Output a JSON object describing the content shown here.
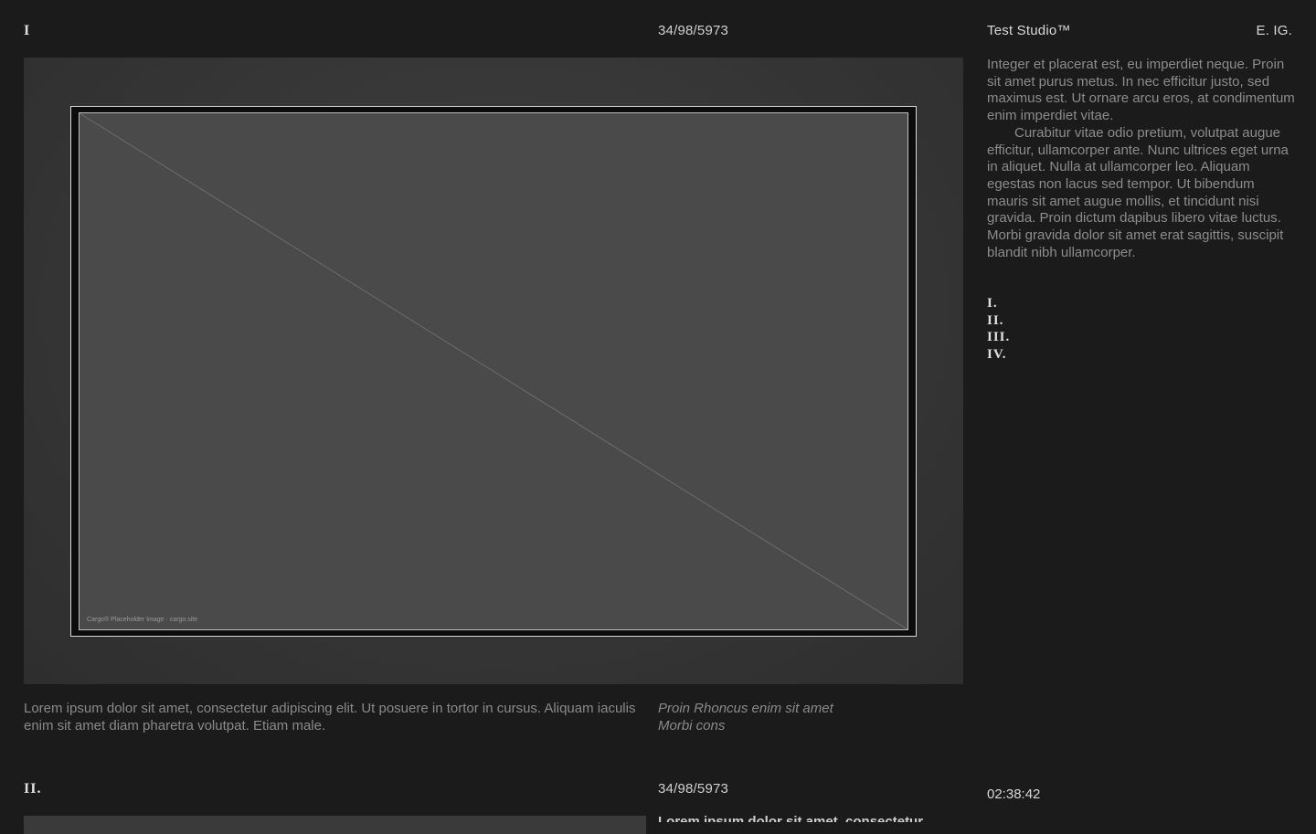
{
  "header": {
    "section_numeral": "I",
    "date": "34/98/5973",
    "studio_name": "Test Studio™",
    "links": "E. IG."
  },
  "hero": {
    "placeholder_label": "Cargo® Placeholder Image · cargo.site"
  },
  "caption": {
    "text": "Lorem ipsum dolor sit amet, consectetur adipiscing elit. Ut posuere in tortor in cursus. Aliquam iaculis enim sit amet diam pharetra volutpat. Etiam male.",
    "italic_line1": "Proin Rhoncus enim sit amet",
    "italic_line2": "Morbi cons"
  },
  "sidebar": {
    "paragraph1": "Integer et placerat est, eu imperdiet neque. Proin sit amet purus metus. In nec efficitur justo, sed maximus est. Ut ornare arcu eros, at condimentum enim imperdiet vitae.",
    "paragraph2": "Curabitur vitae odio pretium, volutpat augue efficitur, ullamcorper ante. Nunc ultrices eget urna in aliquet. Nulla at ullamcorper leo. Aliquam egestas non lacus sed tempor. Ut bibendum mauris sit amet augue mollis, et tincidunt nisi gravida. Proin dictum dapibus libero vitae luctus. Morbi gravida dolor sit amet erat sagittis, suscipit blandit nibh ullamcorper.",
    "toc": [
      "I.",
      "II.",
      "III.",
      "IV."
    ]
  },
  "clock": "02:38:42",
  "section2": {
    "numeral": "II.",
    "date": "34/98/5973",
    "text": "Lorem ipsum dolor sit amet, consectetur"
  }
}
